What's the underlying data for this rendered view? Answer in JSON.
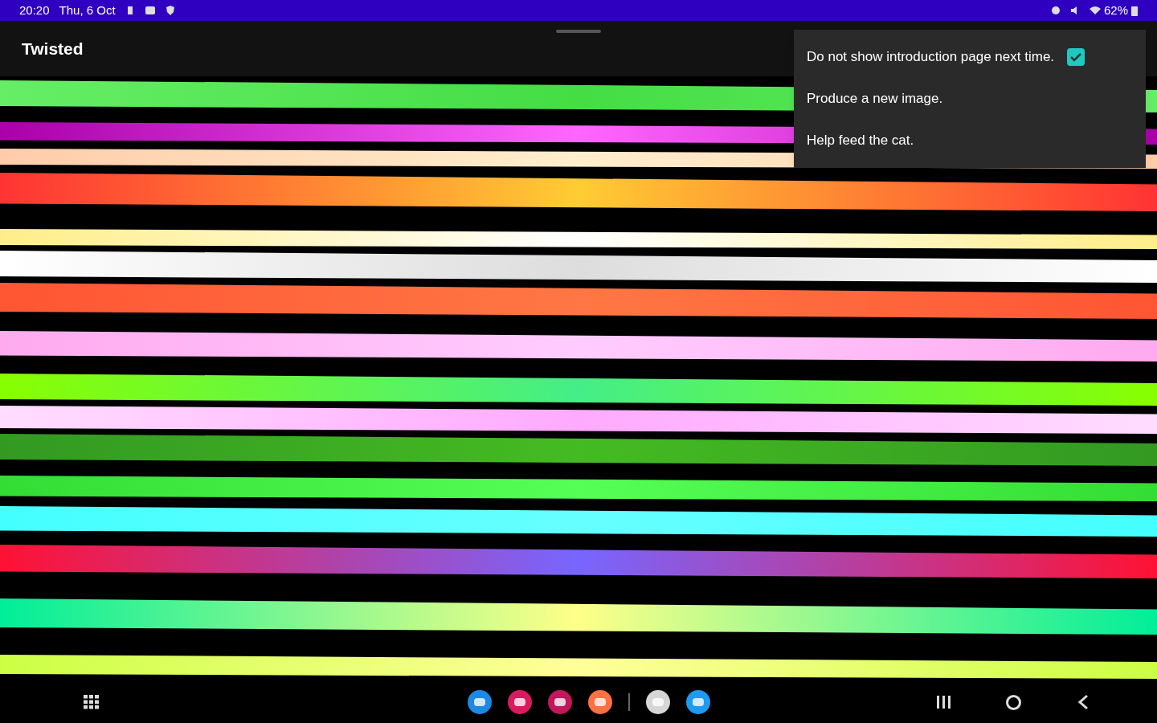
{
  "status_bar": {
    "time": "20:20",
    "date": "Thu, 6 Oct",
    "battery": "62%"
  },
  "app_bar": {
    "title": "Twisted"
  },
  "menu": {
    "items": [
      {
        "kind": "checkbox",
        "label": "Do not show introduction page next time.",
        "checked": true
      },
      {
        "kind": "plain",
        "label": "Produce a new image."
      },
      {
        "kind": "plain",
        "label": "Help feed the cat."
      }
    ]
  },
  "dock": {
    "apps": [
      {
        "color": "#1e88e5"
      },
      {
        "color": "#d81b60"
      },
      {
        "color": "#c2185b"
      },
      {
        "color": "#ff7043"
      },
      {
        "color": "#d6d6d6"
      },
      {
        "color": "#1d9bf0"
      }
    ]
  }
}
